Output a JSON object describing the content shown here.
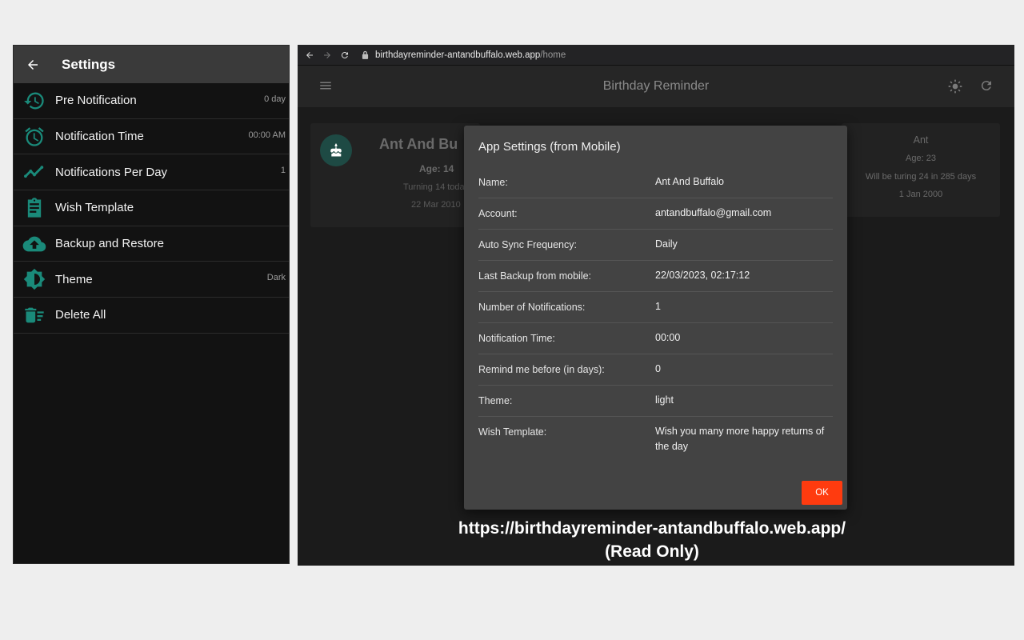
{
  "mobile": {
    "title": "Settings",
    "items": [
      {
        "label": "Pre Notification",
        "value": "0 day",
        "icon": "history-icon"
      },
      {
        "label": "Notification Time",
        "value": "00:00 AM",
        "icon": "alarm-icon"
      },
      {
        "label": "Notifications Per Day",
        "value": "1",
        "icon": "trend-icon"
      },
      {
        "label": "Wish Template",
        "value": "",
        "icon": "clipboard-icon"
      },
      {
        "label": "Backup and Restore",
        "value": "",
        "icon": "cloud-upload-icon"
      },
      {
        "label": "Theme",
        "value": "Dark",
        "icon": "brightness-icon"
      },
      {
        "label": "Delete All",
        "value": "",
        "icon": "delete-sweep-icon"
      }
    ]
  },
  "browser": {
    "url_domain": "birthdayreminder-antandbuffalo.web.app",
    "url_path": "/home",
    "app_title": "Birthday Reminder",
    "card1": {
      "name": "Ant And Bu",
      "age": "Age: 14",
      "turning": "Turning 14 toda",
      "date": "22 Mar 2010"
    },
    "card2": {
      "name": "Ant",
      "age": "Age: 23",
      "turning": "Will be turing 24 in 285 days",
      "date": "1 Jan 2000"
    }
  },
  "dialog": {
    "title": "App Settings (from Mobile)",
    "rows": [
      {
        "key": "Name:",
        "value": "Ant And Buffalo"
      },
      {
        "key": "Account:",
        "value": "antandbuffalo@gmail.com"
      },
      {
        "key": "Auto Sync Frequency:",
        "value": "Daily"
      },
      {
        "key": "Last Backup from mobile:",
        "value": "22/03/2023, 02:17:12"
      },
      {
        "key": "Number of Notifications:",
        "value": "1"
      },
      {
        "key": "Notification Time:",
        "value": "00:00"
      },
      {
        "key": "Remind me before (in days):",
        "value": "0"
      },
      {
        "key": "Theme:",
        "value": "light"
      },
      {
        "key": "Wish Template:",
        "value": "Wish you many more happy returns of the day"
      }
    ],
    "ok_label": "OK"
  },
  "caption": {
    "line1": "https://birthdayreminder-antandbuffalo.web.app/",
    "line2": "(Read Only)"
  },
  "colors": {
    "accent_teal": "#1a8a7a",
    "ok_button": "#ff3b0f"
  }
}
